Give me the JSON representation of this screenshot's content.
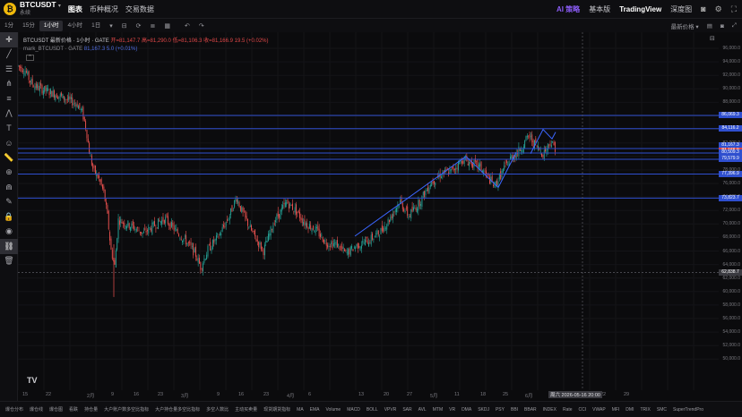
{
  "header": {
    "logo_glyph": "₿",
    "symbol": "BTCUSDT",
    "symbol_caret": "▾",
    "subtitle": "永续",
    "tabs": [
      {
        "label": "图表",
        "active": true
      },
      {
        "label": "币种概况",
        "active": false
      },
      {
        "label": "交易数据",
        "active": false
      }
    ],
    "right": {
      "ai_label": "AI 策略",
      "basic_label": "基本版",
      "tv_label": "TradingView",
      "depth_label": "深度图"
    }
  },
  "toolbar": {
    "timeframes": [
      {
        "label": "1分",
        "active": false
      },
      {
        "label": "15分",
        "active": false
      },
      {
        "label": "1小时",
        "active": true
      },
      {
        "label": "4小时",
        "active": false
      },
      {
        "label": "1日",
        "active": false
      }
    ],
    "price_type": "最新价格 ▾",
    "undo_icon": "↶",
    "redo_icon": "↷"
  },
  "legend": {
    "line1": "BTCUSDT 最新价格 · 1小时 · GATE",
    "open": "开=81,147.7",
    "high": "高=81,290.0",
    "low": "低=81,106.3",
    "close": "收=81,166.9",
    "change": "19.5 (+0.02%)",
    "line2_prefix": "mark_BTCUSDT · GATE",
    "line2_value": "81,167.3 5.0 (+0.01%)",
    "collapse_icon": "^"
  },
  "price_axis": {
    "ticks": [
      "96,000.0",
      "94,000.0",
      "92,000.0",
      "90,000.0",
      "88,000.0",
      "86,000.0",
      "84,000.0",
      "82,000.0",
      "80,000.0",
      "78,000.0",
      "76,000.0",
      "74,000.0",
      "72,000.0",
      "70,000.0",
      "68,000.0",
      "66,000.0",
      "64,000.0",
      "62,000.0",
      "60,000.0",
      "58,000.0",
      "56,000.0",
      "54,000.0",
      "52,000.0",
      "50,000.0"
    ],
    "levels": [
      {
        "label": "86,069.3",
        "value": 86069.3,
        "color": "#2f4fcf"
      },
      {
        "label": "84,116.2",
        "value": 84116.2,
        "color": "#2f4fcf"
      },
      {
        "label": "81,167.3",
        "value": 81167.3,
        "color": "#2f4fcf"
      },
      {
        "label": "81,166.9",
        "value": 81166.9,
        "color": "#d64545"
      },
      {
        "label": "80,509.3",
        "value": 80509.3,
        "color": "#2f4fcf"
      },
      {
        "label": "79,579.9",
        "value": 79579.9,
        "color": "#2f4fcf"
      },
      {
        "label": "77,396.9",
        "value": 77396.9,
        "color": "#2f4fcf"
      },
      {
        "label": "73,823.7",
        "value": 73823.7,
        "color": "#2f4fcf"
      },
      {
        "label": "62,838.7",
        "value": 62838.7,
        "color": "#3a3a40"
      }
    ],
    "crosshair_label": "62,838.7"
  },
  "time_axis": {
    "labels": [
      "15",
      "22",
      "2月",
      "9",
      "16",
      "23",
      "3月",
      "9",
      "16",
      "23",
      "4月",
      "6",
      "13",
      "20",
      "27",
      "5月",
      "11",
      "18",
      "25",
      "6月",
      "8",
      "15",
      "22",
      "29"
    ],
    "highlight": "周六 2026-05-16 20:00"
  },
  "indicators": [
    "爆仓分布",
    "爆仓线",
    "爆仓图",
    "看跌",
    "持仓量",
    "大户账户数多空比指标",
    "大户持仓量多空比指标",
    "多空人数比",
    "主动买卖量",
    "现货期货指标",
    "MA",
    "EMA",
    "Volume",
    "MACD",
    "BOLL",
    "VPVR",
    "SAR",
    "AVL",
    "MTM",
    "VR",
    "DMA",
    "SKDJ",
    "PSY",
    "BBI",
    "BBAR",
    "INDEX",
    "Rate",
    "CCI",
    "VWAP",
    "MFI",
    "DMI",
    "TRIX",
    "SMC",
    "SuperTrendPro"
  ],
  "colors": {
    "up": "#26a69a",
    "down": "#ef5350",
    "level_line": "#2f4fcf",
    "accent_ai": "#8b5cf6"
  }
}
